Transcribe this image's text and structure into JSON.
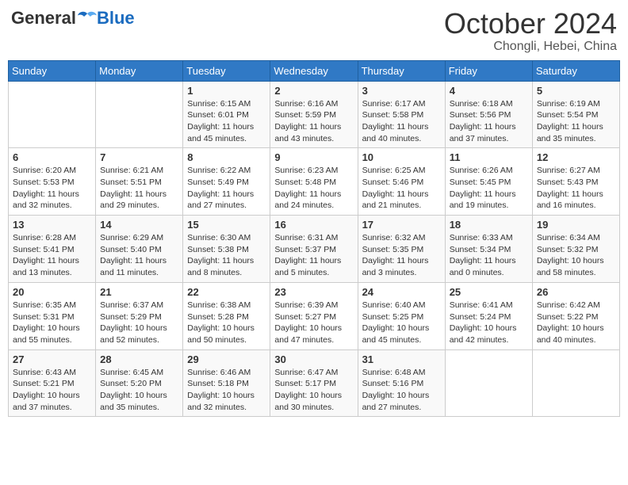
{
  "header": {
    "logo": {
      "general": "General",
      "blue": "Blue"
    },
    "title": "October 2024",
    "subtitle": "Chongli, Hebei, China"
  },
  "days_of_week": [
    "Sunday",
    "Monday",
    "Tuesday",
    "Wednesday",
    "Thursday",
    "Friday",
    "Saturday"
  ],
  "weeks": [
    [
      {
        "day": null
      },
      {
        "day": null
      },
      {
        "day": 1,
        "sunrise": "6:15 AM",
        "sunset": "6:01 PM",
        "daylight": "11 hours and 45 minutes."
      },
      {
        "day": 2,
        "sunrise": "6:16 AM",
        "sunset": "5:59 PM",
        "daylight": "11 hours and 43 minutes."
      },
      {
        "day": 3,
        "sunrise": "6:17 AM",
        "sunset": "5:58 PM",
        "daylight": "11 hours and 40 minutes."
      },
      {
        "day": 4,
        "sunrise": "6:18 AM",
        "sunset": "5:56 PM",
        "daylight": "11 hours and 37 minutes."
      },
      {
        "day": 5,
        "sunrise": "6:19 AM",
        "sunset": "5:54 PM",
        "daylight": "11 hours and 35 minutes."
      }
    ],
    [
      {
        "day": 6,
        "sunrise": "6:20 AM",
        "sunset": "5:53 PM",
        "daylight": "11 hours and 32 minutes."
      },
      {
        "day": 7,
        "sunrise": "6:21 AM",
        "sunset": "5:51 PM",
        "daylight": "11 hours and 29 minutes."
      },
      {
        "day": 8,
        "sunrise": "6:22 AM",
        "sunset": "5:49 PM",
        "daylight": "11 hours and 27 minutes."
      },
      {
        "day": 9,
        "sunrise": "6:23 AM",
        "sunset": "5:48 PM",
        "daylight": "11 hours and 24 minutes."
      },
      {
        "day": 10,
        "sunrise": "6:25 AM",
        "sunset": "5:46 PM",
        "daylight": "11 hours and 21 minutes."
      },
      {
        "day": 11,
        "sunrise": "6:26 AM",
        "sunset": "5:45 PM",
        "daylight": "11 hours and 19 minutes."
      },
      {
        "day": 12,
        "sunrise": "6:27 AM",
        "sunset": "5:43 PM",
        "daylight": "11 hours and 16 minutes."
      }
    ],
    [
      {
        "day": 13,
        "sunrise": "6:28 AM",
        "sunset": "5:41 PM",
        "daylight": "11 hours and 13 minutes."
      },
      {
        "day": 14,
        "sunrise": "6:29 AM",
        "sunset": "5:40 PM",
        "daylight": "11 hours and 11 minutes."
      },
      {
        "day": 15,
        "sunrise": "6:30 AM",
        "sunset": "5:38 PM",
        "daylight": "11 hours and 8 minutes."
      },
      {
        "day": 16,
        "sunrise": "6:31 AM",
        "sunset": "5:37 PM",
        "daylight": "11 hours and 5 minutes."
      },
      {
        "day": 17,
        "sunrise": "6:32 AM",
        "sunset": "5:35 PM",
        "daylight": "11 hours and 3 minutes."
      },
      {
        "day": 18,
        "sunrise": "6:33 AM",
        "sunset": "5:34 PM",
        "daylight": "11 hours and 0 minutes."
      },
      {
        "day": 19,
        "sunrise": "6:34 AM",
        "sunset": "5:32 PM",
        "daylight": "10 hours and 58 minutes."
      }
    ],
    [
      {
        "day": 20,
        "sunrise": "6:35 AM",
        "sunset": "5:31 PM",
        "daylight": "10 hours and 55 minutes."
      },
      {
        "day": 21,
        "sunrise": "6:37 AM",
        "sunset": "5:29 PM",
        "daylight": "10 hours and 52 minutes."
      },
      {
        "day": 22,
        "sunrise": "6:38 AM",
        "sunset": "5:28 PM",
        "daylight": "10 hours and 50 minutes."
      },
      {
        "day": 23,
        "sunrise": "6:39 AM",
        "sunset": "5:27 PM",
        "daylight": "10 hours and 47 minutes."
      },
      {
        "day": 24,
        "sunrise": "6:40 AM",
        "sunset": "5:25 PM",
        "daylight": "10 hours and 45 minutes."
      },
      {
        "day": 25,
        "sunrise": "6:41 AM",
        "sunset": "5:24 PM",
        "daylight": "10 hours and 42 minutes."
      },
      {
        "day": 26,
        "sunrise": "6:42 AM",
        "sunset": "5:22 PM",
        "daylight": "10 hours and 40 minutes."
      }
    ],
    [
      {
        "day": 27,
        "sunrise": "6:43 AM",
        "sunset": "5:21 PM",
        "daylight": "10 hours and 37 minutes."
      },
      {
        "day": 28,
        "sunrise": "6:45 AM",
        "sunset": "5:20 PM",
        "daylight": "10 hours and 35 minutes."
      },
      {
        "day": 29,
        "sunrise": "6:46 AM",
        "sunset": "5:18 PM",
        "daylight": "10 hours and 32 minutes."
      },
      {
        "day": 30,
        "sunrise": "6:47 AM",
        "sunset": "5:17 PM",
        "daylight": "10 hours and 30 minutes."
      },
      {
        "day": 31,
        "sunrise": "6:48 AM",
        "sunset": "5:16 PM",
        "daylight": "10 hours and 27 minutes."
      },
      {
        "day": null
      },
      {
        "day": null
      }
    ]
  ],
  "labels": {
    "sunrise": "Sunrise:",
    "sunset": "Sunset:",
    "daylight": "Daylight:"
  }
}
